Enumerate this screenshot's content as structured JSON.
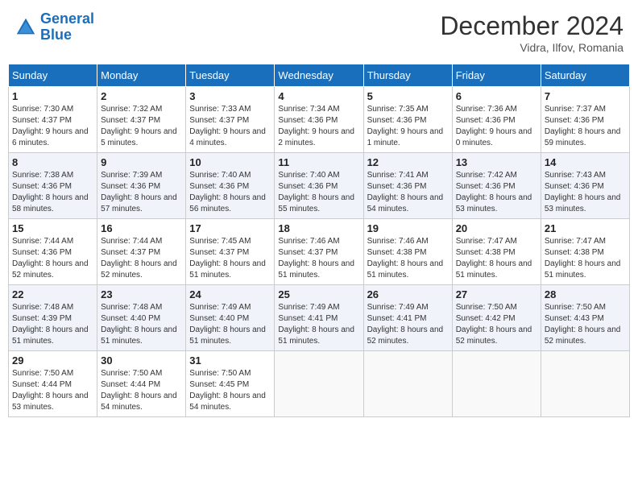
{
  "header": {
    "logo_line1": "General",
    "logo_line2": "Blue",
    "month": "December 2024",
    "location": "Vidra, Ilfov, Romania"
  },
  "days_of_week": [
    "Sunday",
    "Monday",
    "Tuesday",
    "Wednesday",
    "Thursday",
    "Friday",
    "Saturday"
  ],
  "weeks": [
    [
      {
        "day": 1,
        "sunrise": "7:30 AM",
        "sunset": "4:37 PM",
        "daylight": "9 hours and 6 minutes."
      },
      {
        "day": 2,
        "sunrise": "7:32 AM",
        "sunset": "4:37 PM",
        "daylight": "9 hours and 5 minutes."
      },
      {
        "day": 3,
        "sunrise": "7:33 AM",
        "sunset": "4:37 PM",
        "daylight": "9 hours and 4 minutes."
      },
      {
        "day": 4,
        "sunrise": "7:34 AM",
        "sunset": "4:36 PM",
        "daylight": "9 hours and 2 minutes."
      },
      {
        "day": 5,
        "sunrise": "7:35 AM",
        "sunset": "4:36 PM",
        "daylight": "9 hours and 1 minute."
      },
      {
        "day": 6,
        "sunrise": "7:36 AM",
        "sunset": "4:36 PM",
        "daylight": "9 hours and 0 minutes."
      },
      {
        "day": 7,
        "sunrise": "7:37 AM",
        "sunset": "4:36 PM",
        "daylight": "8 hours and 59 minutes."
      }
    ],
    [
      {
        "day": 8,
        "sunrise": "7:38 AM",
        "sunset": "4:36 PM",
        "daylight": "8 hours and 58 minutes."
      },
      {
        "day": 9,
        "sunrise": "7:39 AM",
        "sunset": "4:36 PM",
        "daylight": "8 hours and 57 minutes."
      },
      {
        "day": 10,
        "sunrise": "7:40 AM",
        "sunset": "4:36 PM",
        "daylight": "8 hours and 56 minutes."
      },
      {
        "day": 11,
        "sunrise": "7:40 AM",
        "sunset": "4:36 PM",
        "daylight": "8 hours and 55 minutes."
      },
      {
        "day": 12,
        "sunrise": "7:41 AM",
        "sunset": "4:36 PM",
        "daylight": "8 hours and 54 minutes."
      },
      {
        "day": 13,
        "sunrise": "7:42 AM",
        "sunset": "4:36 PM",
        "daylight": "8 hours and 53 minutes."
      },
      {
        "day": 14,
        "sunrise": "7:43 AM",
        "sunset": "4:36 PM",
        "daylight": "8 hours and 53 minutes."
      }
    ],
    [
      {
        "day": 15,
        "sunrise": "7:44 AM",
        "sunset": "4:36 PM",
        "daylight": "8 hours and 52 minutes."
      },
      {
        "day": 16,
        "sunrise": "7:44 AM",
        "sunset": "4:37 PM",
        "daylight": "8 hours and 52 minutes."
      },
      {
        "day": 17,
        "sunrise": "7:45 AM",
        "sunset": "4:37 PM",
        "daylight": "8 hours and 51 minutes."
      },
      {
        "day": 18,
        "sunrise": "7:46 AM",
        "sunset": "4:37 PM",
        "daylight": "8 hours and 51 minutes."
      },
      {
        "day": 19,
        "sunrise": "7:46 AM",
        "sunset": "4:38 PM",
        "daylight": "8 hours and 51 minutes."
      },
      {
        "day": 20,
        "sunrise": "7:47 AM",
        "sunset": "4:38 PM",
        "daylight": "8 hours and 51 minutes."
      },
      {
        "day": 21,
        "sunrise": "7:47 AM",
        "sunset": "4:38 PM",
        "daylight": "8 hours and 51 minutes."
      }
    ],
    [
      {
        "day": 22,
        "sunrise": "7:48 AM",
        "sunset": "4:39 PM",
        "daylight": "8 hours and 51 minutes."
      },
      {
        "day": 23,
        "sunrise": "7:48 AM",
        "sunset": "4:40 PM",
        "daylight": "8 hours and 51 minutes."
      },
      {
        "day": 24,
        "sunrise": "7:49 AM",
        "sunset": "4:40 PM",
        "daylight": "8 hours and 51 minutes."
      },
      {
        "day": 25,
        "sunrise": "7:49 AM",
        "sunset": "4:41 PM",
        "daylight": "8 hours and 51 minutes."
      },
      {
        "day": 26,
        "sunrise": "7:49 AM",
        "sunset": "4:41 PM",
        "daylight": "8 hours and 52 minutes."
      },
      {
        "day": 27,
        "sunrise": "7:50 AM",
        "sunset": "4:42 PM",
        "daylight": "8 hours and 52 minutes."
      },
      {
        "day": 28,
        "sunrise": "7:50 AM",
        "sunset": "4:43 PM",
        "daylight": "8 hours and 52 minutes."
      }
    ],
    [
      {
        "day": 29,
        "sunrise": "7:50 AM",
        "sunset": "4:44 PM",
        "daylight": "8 hours and 53 minutes."
      },
      {
        "day": 30,
        "sunrise": "7:50 AM",
        "sunset": "4:44 PM",
        "daylight": "8 hours and 54 minutes."
      },
      {
        "day": 31,
        "sunrise": "7:50 AM",
        "sunset": "4:45 PM",
        "daylight": "8 hours and 54 minutes."
      },
      null,
      null,
      null,
      null
    ]
  ]
}
